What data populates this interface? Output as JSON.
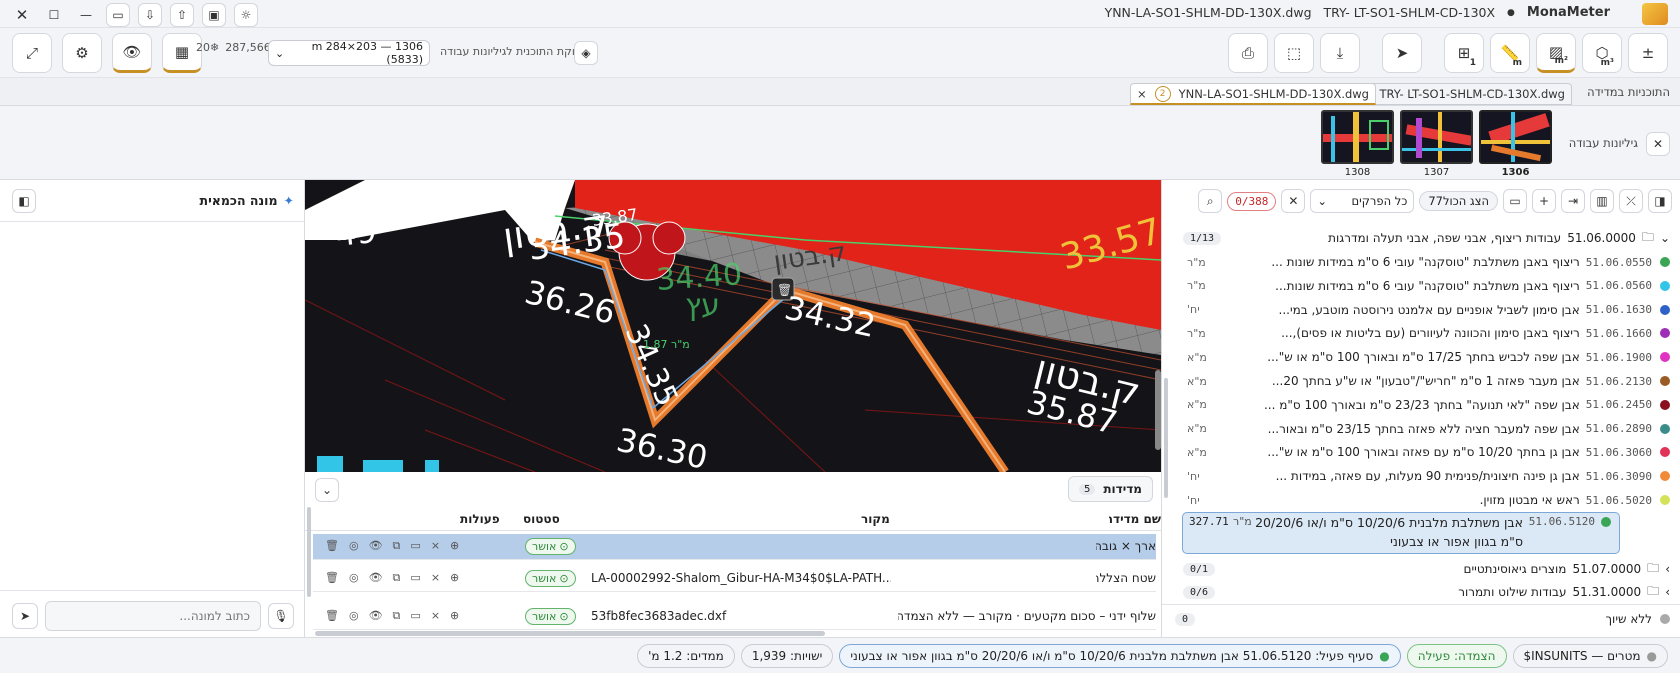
{
  "titlebar": {
    "app_name": "MonaMeter",
    "open_files": [
      "YNN-LA-SO1-SHLM-DD-130X.dwg",
      "TRY- LT-SO1-SHLM-CD-130X"
    ]
  },
  "toolbar": {
    "sheet_selector_label": "חלוקת התוכנית לגיליונות עבודה",
    "sheet_selector_value": "1306 — 203×284 m (5833)",
    "coord_readout": "287,566–",
    "zoom_readout": "20❄",
    "area_unit": "m²",
    "length_unit": "m",
    "volume_unit": "m³",
    "count_label": "1"
  },
  "plan_tabs": {
    "label": "התוכניות במדידה",
    "tabs": [
      {
        "number": "3",
        "name": "TRY- LT-SO1-SHLM-CD-130X.dwg"
      },
      {
        "number": "2",
        "name": "YNN-LA-SO1-SHLM-DD-130X.dwg"
      }
    ]
  },
  "sheets": {
    "label": "גיליונות עבודה",
    "items": [
      "1306",
      "1307",
      "1308"
    ]
  },
  "assistant": {
    "title": "מונה הכמאית",
    "input_placeholder": "כתוב למונה..."
  },
  "canvas_labels": {
    "texts": [
      "ק.בטון",
      "49",
      "34.35",
      "36.26",
      "34.40",
      "34.32",
      "34.35",
      "36.30",
      "ק.בטון",
      "35.87",
      "33.57",
      "ק.בטון",
      "עץ",
      "33.87",
      "מ\"ר 1.87"
    ]
  },
  "measurements": {
    "title": "מדידות",
    "count": "5",
    "columns": {
      "name": "שם מדידה",
      "source": "מקור",
      "status": "סטטוס",
      "actions": "פעולות"
    },
    "rows": [
      {
        "name": "ארך × גובה",
        "source": "",
        "status": "אושר",
        "selected": true
      },
      {
        "name": "שטח הצללה",
        "source": "LA-00002992-Shalom_Gibur-HA-M34$0$LA-PATH...",
        "status": "אושר",
        "selected": false
      },
      {
        "name": "שלוף ידני – סכום מקטעים · מקורב — ללא הצמדה",
        "source": "53fb8fec3683adec.dxf",
        "status": "אושר",
        "selected": false
      }
    ]
  },
  "tree": {
    "search_count": "0/388",
    "filter_value": "כל הפרקים",
    "show_all_label": "הצג הכול77",
    "sections": [
      {
        "code": "51.06.0000",
        "title": "עבודות ריצוף, אבני שפה, אבני תעלה ומדרגות",
        "badge": "1/13",
        "expanded": true
      }
    ],
    "items": [
      {
        "code": "51.06.0550",
        "title": "ריצוף באבן משתלבת \"טוסקנה\" עובי 6 ס\"מ במידות שונות ...",
        "unit": "מ\"ר",
        "color": "#3aa655",
        "qty": ""
      },
      {
        "code": "51.06.0560",
        "title": "ריצוף באבן משתלבת \"טוסקנה\" עובי 6 ס\"מ במידות שונות...",
        "unit": "מ\"ר",
        "color": "#33c5e8",
        "qty": ""
      },
      {
        "code": "51.06.1630",
        "title": "אבן סימון לשביל אופניים עם אלמנט נירוסטה מוטבע, במי...",
        "unit": "יח'",
        "color": "#2f62c9",
        "qty": ""
      },
      {
        "code": "51.06.1660",
        "title": "ריצוף באבן סימון והכוונה לעיוורים (עם בליטות או פסים),...",
        "unit": "מ\"ר",
        "color": "#9c2fb5",
        "qty": ""
      },
      {
        "code": "51.06.1900",
        "title": "אבן שפה לכביש בחתך 17/25 ס\"מ ובאורך 100 ס\"מ או ש\"...",
        "unit": "מ\"א",
        "color": "#e033c2",
        "qty": ""
      },
      {
        "code": "51.06.2130",
        "title": "אבן מעבר פאזה 1 ס\"מ \"חריש\"/\"טבעון\" או ש\"ע בחתך 20...",
        "unit": "מ\"א",
        "color": "#9a5b25",
        "qty": ""
      },
      {
        "code": "51.06.2450",
        "title": "אבן שפה \"לאי תנועה\" בחתך 23/23 ס\"מ ובאורך 100 ס\"מ ...",
        "unit": "מ\"א",
        "color": "#8a1020",
        "qty": ""
      },
      {
        "code": "51.06.2890",
        "title": "אבן שפה למעבר חציה ללא פאזה בחתך 23/15 ס\"מ ובאור...",
        "unit": "מ\"א",
        "color": "#3b8d8a",
        "qty": ""
      },
      {
        "code": "51.06.3060",
        "title": "אבן גן בחתך 10/20 ס\"מ עם פאזה ובאורך 100 ס\"מ או ש\"...",
        "unit": "מ\"א",
        "color": "#e03356",
        "qty": ""
      },
      {
        "code": "51.06.3090",
        "title": "אבן גן פינה חיצונית/פנימית 90 מעלות, עם פאזה, במידות ...",
        "unit": "יח'",
        "color": "#f08b3a",
        "qty": ""
      },
      {
        "code": "51.06.5020",
        "title": "ראש אי מבטון מזוין.",
        "unit": "יח'",
        "color": "#d4e25a",
        "qty": ""
      }
    ],
    "active_item": {
      "code": "51.06.5120",
      "title_line1": "אבן משתלבת מלבנית 10/20/6 ס\"מ ו/או 20/20/6",
      "title_line2": "ס\"מ בגוון אפור או צבעוני",
      "unit": "מ\"ר",
      "qty": "327.71",
      "color": "#3aa655"
    },
    "collapsed_sections": [
      {
        "code": "51.07.0000",
        "title": "מוצרים גיאוסינתטיים",
        "badge": "0/1"
      },
      {
        "code": "51.31.0000",
        "title": "עבודות שילוט ותמרור",
        "badge": "0/6"
      }
    ],
    "unassigned": {
      "label": "ללא שיוך",
      "badge": "0"
    }
  },
  "status": {
    "units": "מטרים — INSUNITS$",
    "snap": "הצמדה: פעילה",
    "active_item": "סעיף פעיל: 51.06.5120 אבן משתלבת מלבנית 10/20/6 ס\"מ ו/או 20/20/6 ס\"מ בגוון אפור או צבעוני",
    "entities": "ישויות: 1,939",
    "dims": "ממדים: 1.2 מ'"
  }
}
